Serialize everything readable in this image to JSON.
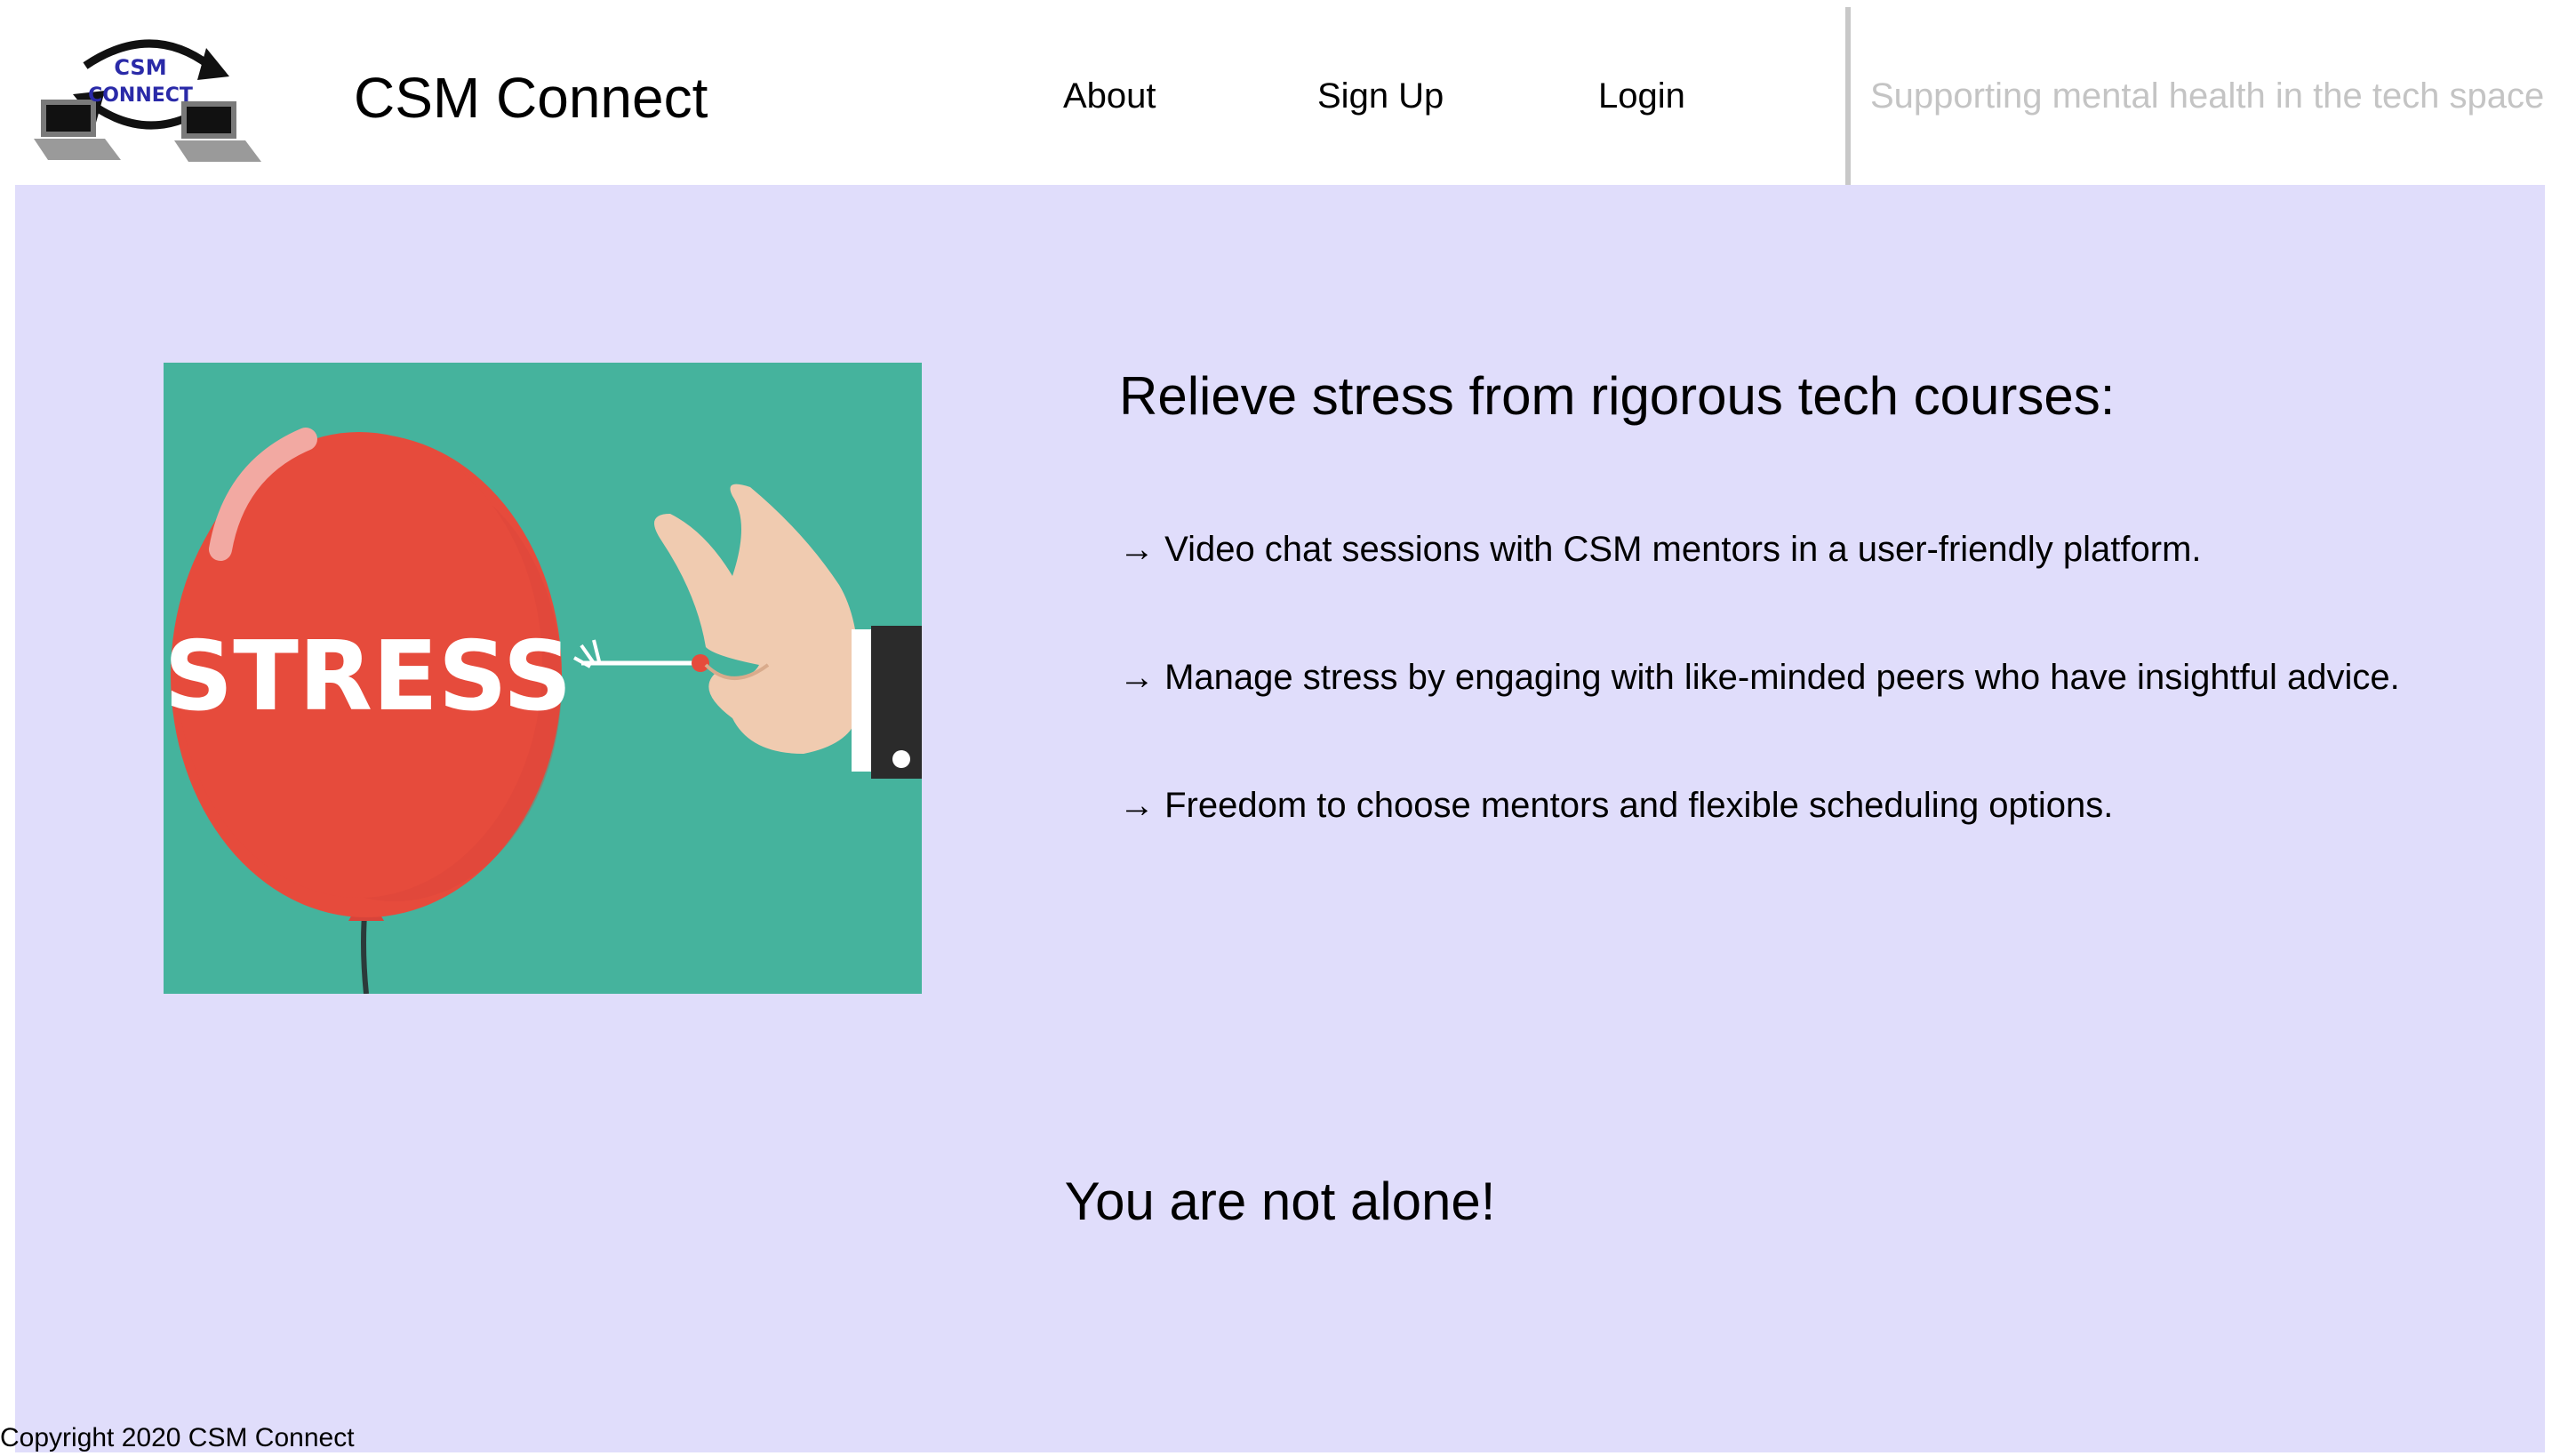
{
  "header": {
    "logo": {
      "line1": "CSM",
      "line2": "CONNECT"
    },
    "site_title": "CSM Connect",
    "nav": {
      "about": "About",
      "signup": "Sign Up",
      "login": "Login"
    },
    "tagline": "Supporting mental health in the tech space"
  },
  "main": {
    "hero_image": {
      "balloon_text": "STRESS",
      "icon": "balloon-pin-illustration"
    },
    "headline": "Relieve stress from rigorous tech courses:",
    "features": [
      "→ Video chat sessions with CSM mentors in a user-friendly platform.",
      "→ Manage stress by engaging with like-minded peers who have insightful advice.",
      "→ Freedom to choose mentors and flexible scheduling options."
    ],
    "closing": "You are not alone!"
  },
  "footer": {
    "copyright": "Copyright 2020 CSM Connect"
  },
  "colors": {
    "background": "#e0ddfb",
    "image_bg": "#45b39d",
    "balloon": "#e64b3c",
    "tagline": "#c4c4c4"
  }
}
